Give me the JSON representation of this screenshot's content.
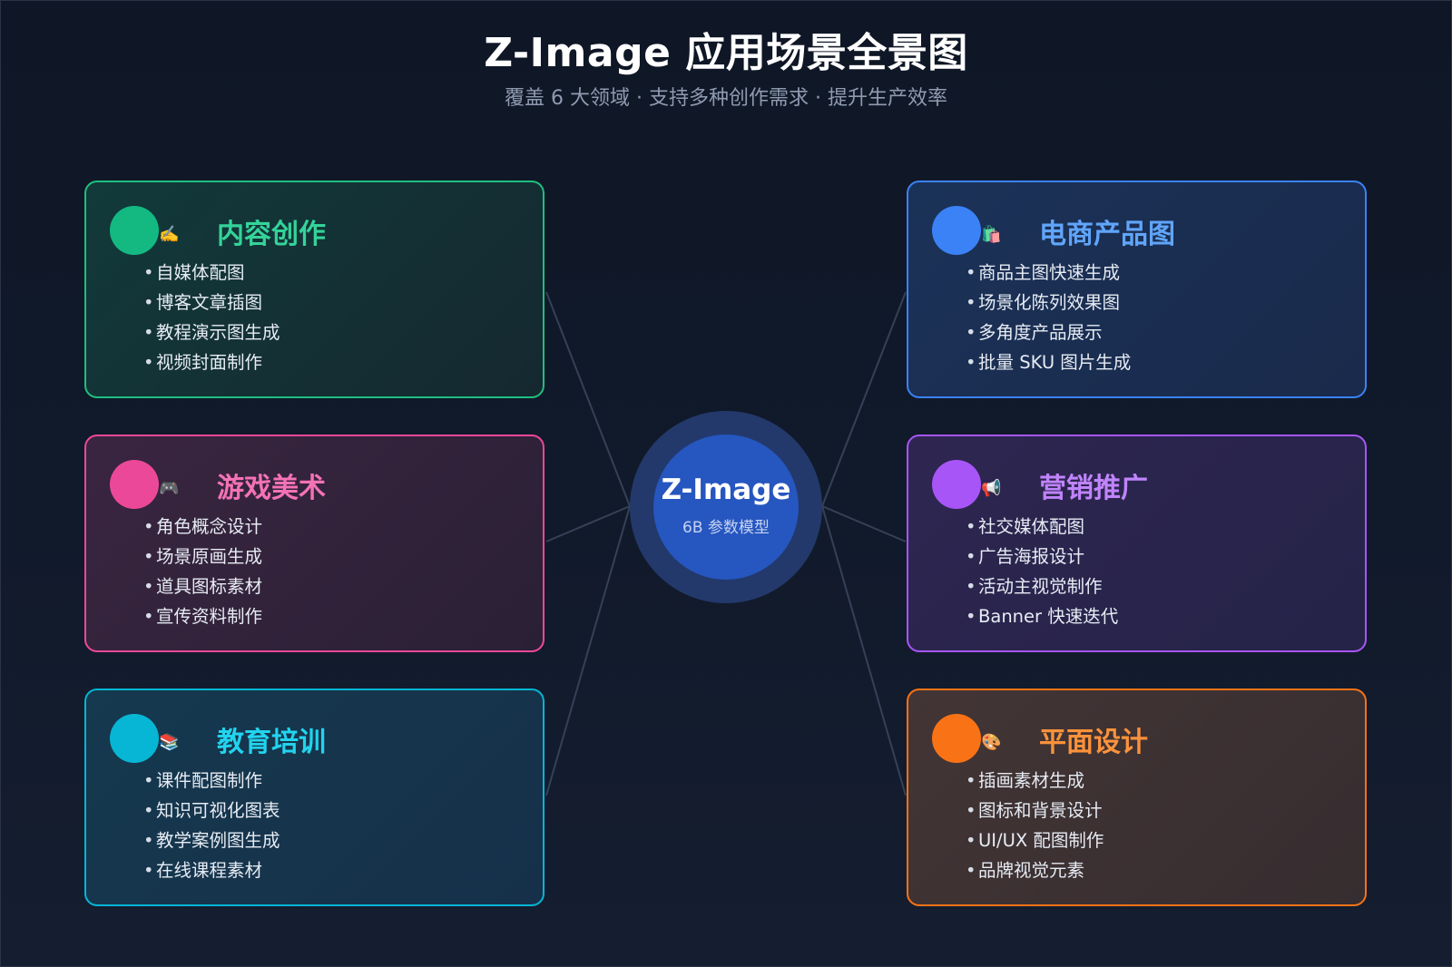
{
  "header": {
    "title": "Z-Image 应用场景全景图",
    "subtitle": "覆盖 6 大领域 · 支持多种创作需求 · 提升生产效率"
  },
  "hub": {
    "title": "Z-Image",
    "subtitle": "6B 参数模型",
    "color": "#2656bf"
  },
  "cards": [
    {
      "title": "内容创作",
      "emoji": "✍️",
      "icon": "writing-hand-icon",
      "accent": "#1fbf7f",
      "dot": "#13b981",
      "items": [
        "自媒体配图",
        "博客文章插图",
        "教程演示图生成",
        "视频封面制作"
      ]
    },
    {
      "title": "游戏美术",
      "emoji": "🎮",
      "icon": "game-controller-icon",
      "accent": "#ec4899",
      "dot": "#ec4899",
      "items": [
        "角色概念设计",
        "场景原画生成",
        "道具图标素材",
        "宣传资料制作"
      ]
    },
    {
      "title": "教育培训",
      "emoji": "📚",
      "icon": "books-icon",
      "accent": "#06b6d4",
      "dot": "#06b6d4",
      "items": [
        "课件配图制作",
        "知识可视化图表",
        "教学案例图生成",
        "在线课程素材"
      ]
    },
    {
      "title": "电商产品图",
      "emoji": "🛍️",
      "icon": "shopping-bags-icon",
      "accent": "#3b82f6",
      "dot": "#3b82f6",
      "items": [
        "商品主图快速生成",
        "场景化陈列效果图",
        "多角度产品展示",
        "批量 SKU 图片生成"
      ]
    },
    {
      "title": "营销推广",
      "emoji": "📢",
      "icon": "megaphone-icon",
      "accent": "#a855f7",
      "dot": "#a855f7",
      "items": [
        "社交媒体配图",
        "广告海报设计",
        "活动主视觉制作",
        "Banner 快速迭代"
      ]
    },
    {
      "title": "平面设计",
      "emoji": "🎨",
      "icon": "palette-icon",
      "accent": "#f97316",
      "dot": "#f97316",
      "items": [
        "插画素材生成",
        "图标和背景设计",
        "UI/UX 配图制作",
        "品牌视觉元素"
      ]
    }
  ]
}
